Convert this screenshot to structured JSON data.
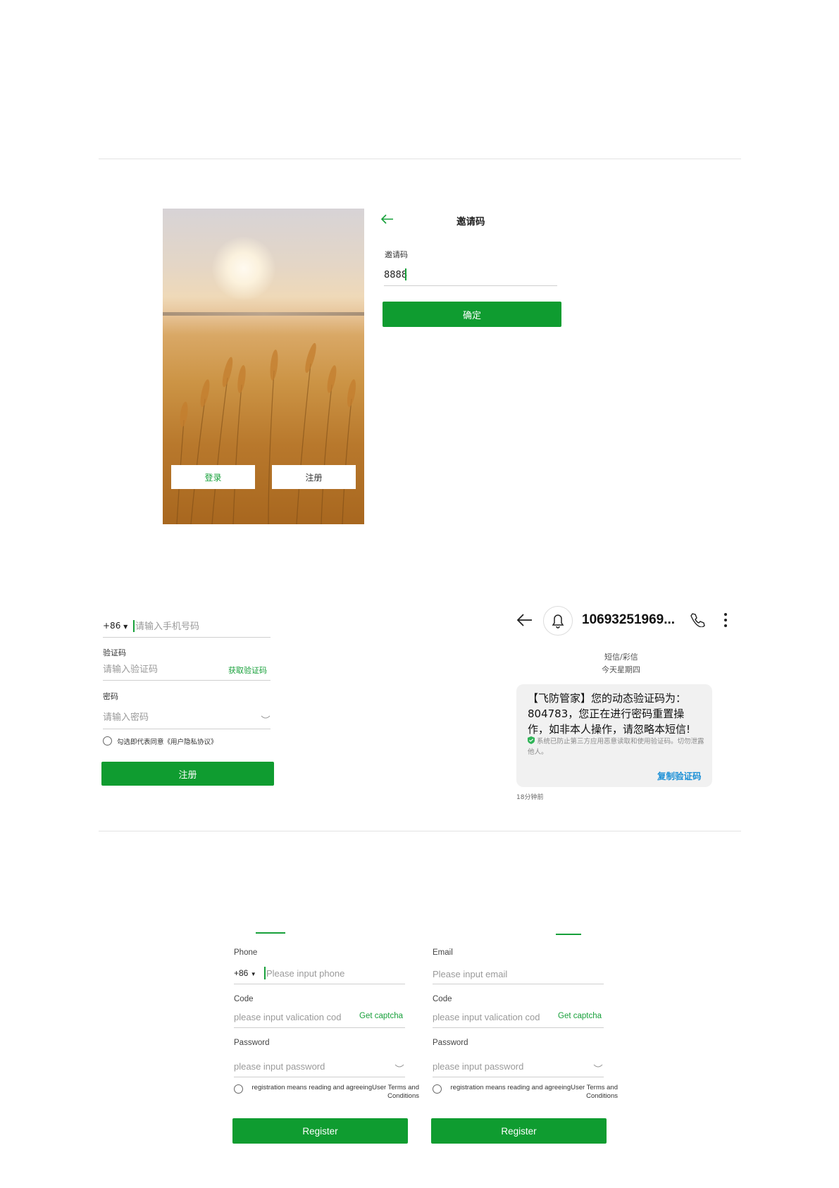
{
  "splash": {
    "login_label": "登录",
    "register_label": "注册"
  },
  "invite": {
    "title": "邀请码",
    "field_label": "邀请码",
    "field_value": "8888",
    "confirm_label": "确定",
    "accent_color": "#17a03a"
  },
  "register_cn": {
    "country_code": "+86",
    "phone_placeholder": "请输入手机号码",
    "code_label": "验证码",
    "code_placeholder": "请输入验证码",
    "get_code_label": "获取验证码",
    "password_label": "密码",
    "password_placeholder": "请输入密码",
    "agreement_text": "勾选即代表同意《用户隐私协议》",
    "register_label": "注册"
  },
  "sms": {
    "sender": "10693251969...",
    "category": "短信/彩信",
    "day": "今天星期四",
    "message": "【飞防管家】您的动态验证码为：804783，您正在进行密码重置操作，如非本人操作，请忽略本短信!",
    "security_note": "系统已防止第三方应用恶意读取和使用验证码。切勿泄露他人。",
    "copy_code_label": "复制验证码",
    "time_ago": "18分钟前"
  },
  "register_en_phone": {
    "phone_label": "Phone",
    "country_code": "+86",
    "phone_placeholder": "Please input phone",
    "code_label": "Code",
    "code_placeholder": "please input valication cod",
    "get_captcha_label": "Get captcha",
    "password_label": "Password",
    "password_placeholder": "please input password",
    "agreement_prefix": "registration means reading and agreeing",
    "agreement_link": "User Terms and Conditions",
    "register_label": "Register"
  },
  "register_en_email": {
    "email_label": "Email",
    "email_placeholder": "Please input email",
    "code_label": "Code",
    "code_placeholder": "please input valication cod",
    "get_captcha_label": "Get captcha",
    "password_label": "Password",
    "password_placeholder": "please input password",
    "agreement_prefix": "registration means reading and agreeing",
    "agreement_link": "User Terms and Conditions",
    "register_label": "Register"
  },
  "colors": {
    "primary": "#0f9c30",
    "link": "#17a03a",
    "sms_link": "#1a8fd6"
  }
}
